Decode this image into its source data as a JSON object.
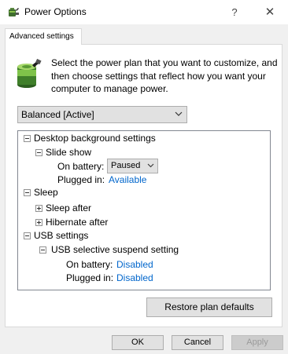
{
  "window": {
    "title": "Power Options",
    "help_glyph": "?",
    "close_glyph": "✕",
    "icon": "power-options-icon"
  },
  "tabs": [
    {
      "label": "Advanced settings",
      "active": true
    }
  ],
  "intro": {
    "icon": "battery-icon",
    "text": "Select the power plan that you want to customize, and then choose settings that reflect how you want your computer to manage power."
  },
  "plan_select": {
    "value": "Balanced [Active]"
  },
  "tree": {
    "desktop_background": {
      "label": "Desktop background settings",
      "slide_show": {
        "label": "Slide show",
        "on_battery_label": "On battery:",
        "on_battery_value": "Paused",
        "plugged_in_label": "Plugged in:",
        "plugged_in_value": "Available"
      }
    },
    "sleep": {
      "label": "Sleep",
      "sleep_after": "Sleep after",
      "hibernate_after": "Hibernate after"
    },
    "usb": {
      "label": "USB settings",
      "suspend": {
        "label": "USB selective suspend setting",
        "on_battery_label": "On battery:",
        "on_battery_value": "Disabled",
        "plugged_in_label": "Plugged in:",
        "plugged_in_value": "Disabled"
      }
    }
  },
  "buttons": {
    "restore": "Restore plan defaults",
    "ok": "OK",
    "cancel": "Cancel",
    "apply": "Apply"
  },
  "colors": {
    "link": "#0066cc",
    "panel": "#ffffff",
    "chrome": "#f0f0f0"
  }
}
